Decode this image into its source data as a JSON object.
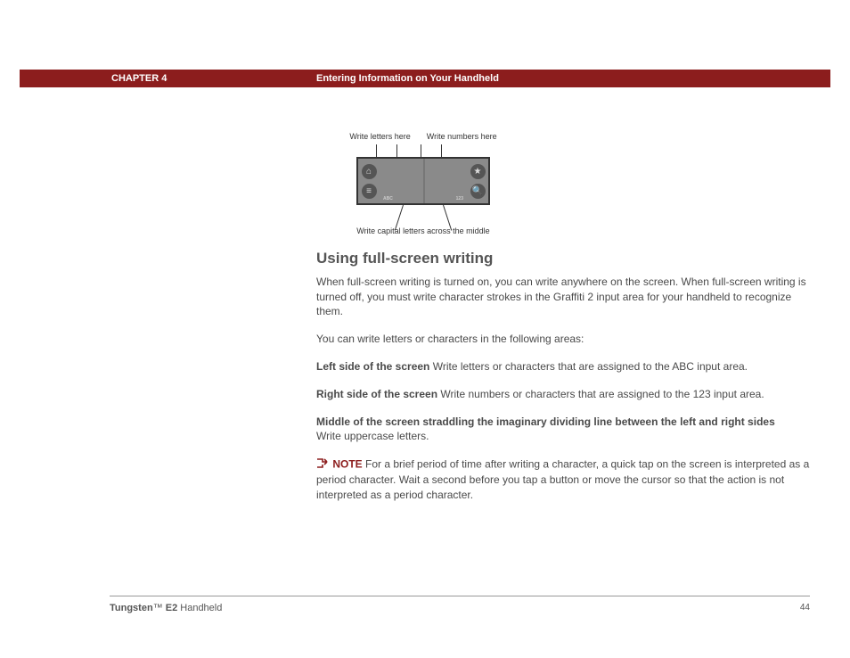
{
  "header": {
    "chapter": "CHAPTER 4",
    "section": "Entering Information on Your Handheld"
  },
  "diagram": {
    "top_left": "Write letters here",
    "top_right": "Write numbers here",
    "bottom": "Write capital letters across the middle",
    "abc": "ABC",
    "num": "123"
  },
  "body": {
    "heading": "Using full-screen writing",
    "p1": "When full-screen writing is turned on, you can write anywhere on the screen. When full-screen writing is turned off, you must write character strokes in the Graffiti 2 input area for your handheld to recognize them.",
    "p2": "You can write letters or characters in the following areas:",
    "left_term": "Left side of the screen",
    "left_desc": "   Write letters or characters that are assigned to the ABC input area.",
    "right_term": "Right side of the screen",
    "right_desc": "   Write numbers or characters that are assigned to the 123 input area.",
    "mid_term": "Middle of the screen straddling the imaginary dividing line between the left and right sides",
    "mid_desc": "Write uppercase letters.",
    "note_label": "NOTE",
    "note_text": "   For a brief period of time after writing a character, a quick tap on the screen is interpreted as a period character. Wait a second before you tap a button or move the cursor so that the action is not interpreted as a period character."
  },
  "footer": {
    "product_bold": "Tungsten",
    "product_tm": "™",
    "product_model": " E2",
    "product_suffix": " Handheld",
    "page": "44"
  }
}
